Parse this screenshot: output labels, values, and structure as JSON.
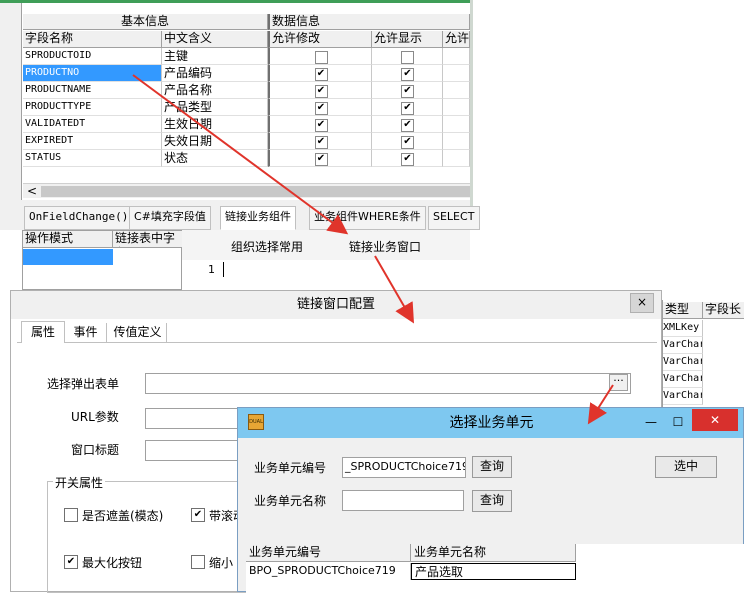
{
  "top_grid": {
    "group_basic": "基本信息",
    "group_data": "数据信息",
    "col_field": "字段名称",
    "col_meaning": "中文含义",
    "col_allow_edit": "允许修改",
    "col_allow_show": "允许显示",
    "col_allow_more": "允许",
    "rows": [
      {
        "field": "SPRODUCTOID",
        "meaning": "主键",
        "edit": false,
        "show": false
      },
      {
        "field": "PRODUCTNO",
        "meaning": "产品编码",
        "edit": true,
        "show": true
      },
      {
        "field": "PRODUCTNAME",
        "meaning": "产品名称",
        "edit": true,
        "show": true
      },
      {
        "field": "PRODUCTTYPE",
        "meaning": "产品类型",
        "edit": true,
        "show": true
      },
      {
        "field": "VALIDATEDT",
        "meaning": "生效日期",
        "edit": true,
        "show": true
      },
      {
        "field": "EXPIREDT",
        "meaning": "失效日期",
        "edit": true,
        "show": true
      },
      {
        "field": "STATUS",
        "meaning": "状态",
        "edit": true,
        "show": true
      }
    ],
    "scroll_left": "<"
  },
  "tabs": [
    "OnFieldChange()",
    "C#填充字段值",
    "链接业务组件",
    "业务组件WHERE条件",
    "SELECT"
  ],
  "sub_grid": {
    "col_mode": "操作模式",
    "col_link": "链接表中字段"
  },
  "sub_tabs": {
    "org": "组织选择常用",
    "link": "链接业务窗口"
  },
  "editor": {
    "line1": "1"
  },
  "right_grid": {
    "col_type": "类型",
    "col_len": "字段长",
    "rows": [
      "XMLKey",
      "VarChar",
      "VarChar",
      "VarChar",
      "VarChar"
    ]
  },
  "dlg1": {
    "title": "链接窗口配置",
    "close": "×",
    "tabs": [
      "属性",
      "事件",
      "传值定义"
    ],
    "label_form": "选择弹出表单",
    "label_url": "URL参数",
    "label_wtitle": "窗口标题",
    "browse": "···",
    "group_switch": "开关属性",
    "chk_modal": "是否遮盖(模态)",
    "chk_scroll": "带滚动",
    "chk_max": "最大化按钮",
    "chk_min": "缩小",
    "chk_check": "✔"
  },
  "dlg2": {
    "title": "选择业务单元",
    "app_icon": "DUAL",
    "minimize": "—",
    "maximize": "☐",
    "close": "✕",
    "label_no": "业务单元编号",
    "label_name": "业务单元名称",
    "no_value": "_SPRODUCTChoice719",
    "name_value": "",
    "query": "查询",
    "select": "选中",
    "col_no": "业务单元编号",
    "col_name": "业务单元名称",
    "rows": [
      {
        "no": "BPO_SPRODUCTChoice719",
        "name": "产品选取"
      }
    ]
  },
  "colors": {
    "selection": "#3399ff",
    "arrow": "#e0342b",
    "dlg2_title": "#7ec8f0"
  }
}
